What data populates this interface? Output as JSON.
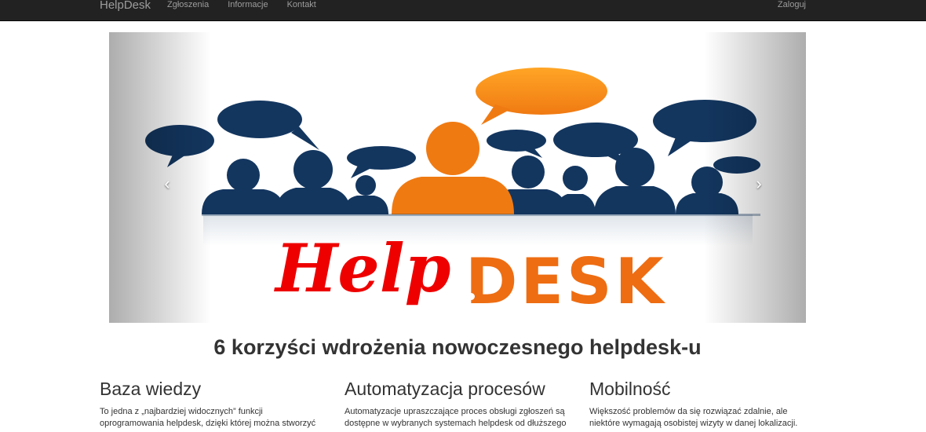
{
  "navbar": {
    "brand": "HelpDesk",
    "links": [
      "Zgłoszenia",
      "Informacje",
      "Kontakt"
    ],
    "login": "Zaloguj"
  },
  "carousel": {
    "logo_help": "Help",
    "logo_desk": "DESK",
    "prev_glyph": "‹",
    "next_glyph": "›",
    "indicator_count": 2,
    "active_indicator": 2
  },
  "main": {
    "heading": "6 korzyści wdrożenia nowoczesnego helpdesk-u",
    "columns": [
      {
        "title": "Baza wiedzy",
        "text": "To jedna z „najbardziej widocznych” funkcji oprogramowania helpdesk, dzięki której można stworzyć"
      },
      {
        "title": "Automatyzacja procesów",
        "text": "Automatyzacje upraszczające proces obsługi zgłoszeń są dostępne w wybranych systemach helpdesk od dłuższego"
      },
      {
        "title": "Mobilność",
        "text": "Większość problemów da się rozwiązać zdalnie, ale niektóre wymagają osobistej wizyty w danej lokalizacji."
      }
    ]
  },
  "colors": {
    "navbar_bg": "#222222",
    "nav_text": "#9d9d9d",
    "figure_navy": "#13365f",
    "figure_orange": "#f07a12",
    "help_red": "#ee0000",
    "desk_orange": "#ee6d12"
  }
}
